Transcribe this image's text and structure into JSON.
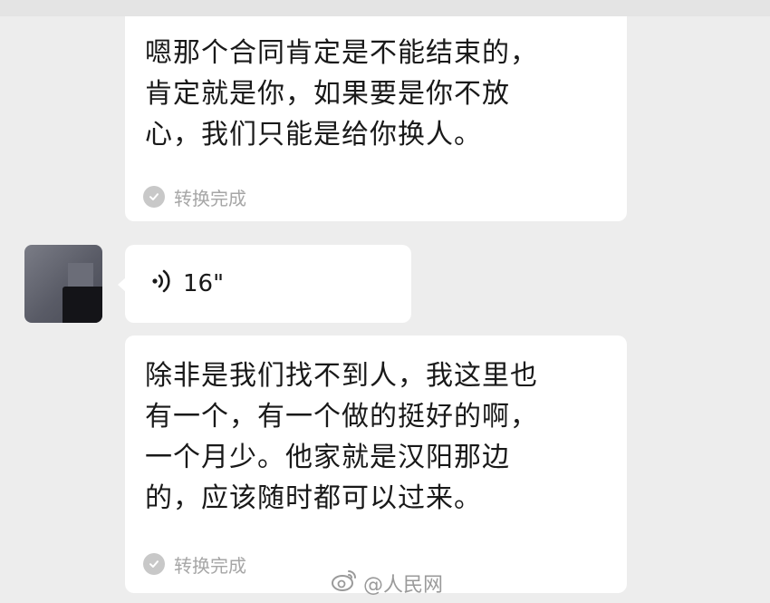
{
  "messages": [
    {
      "transcript": "嗯那个合同肯定是不能结束的，\n肯定就是你，如果要是你不放\n心，我们只能是给你换人。",
      "status": "转换完成"
    },
    {
      "voice_duration": "16\""
    },
    {
      "transcript": "除非是我们找不到人，我这里也\n有一个，有一个做的挺好的啊，\n一个月少。他家就是汉阳那边\n的，应该随时都可以过来。",
      "status": "转换完成"
    }
  ],
  "watermark": {
    "text": "@人民网",
    "icon": "weibo-icon"
  },
  "icons": {
    "check": "check-circle-icon",
    "voice": "voice-wave-icon"
  },
  "colors": {
    "background": "#ededed",
    "bubble": "#ffffff",
    "status_text": "#a6a6a6"
  }
}
